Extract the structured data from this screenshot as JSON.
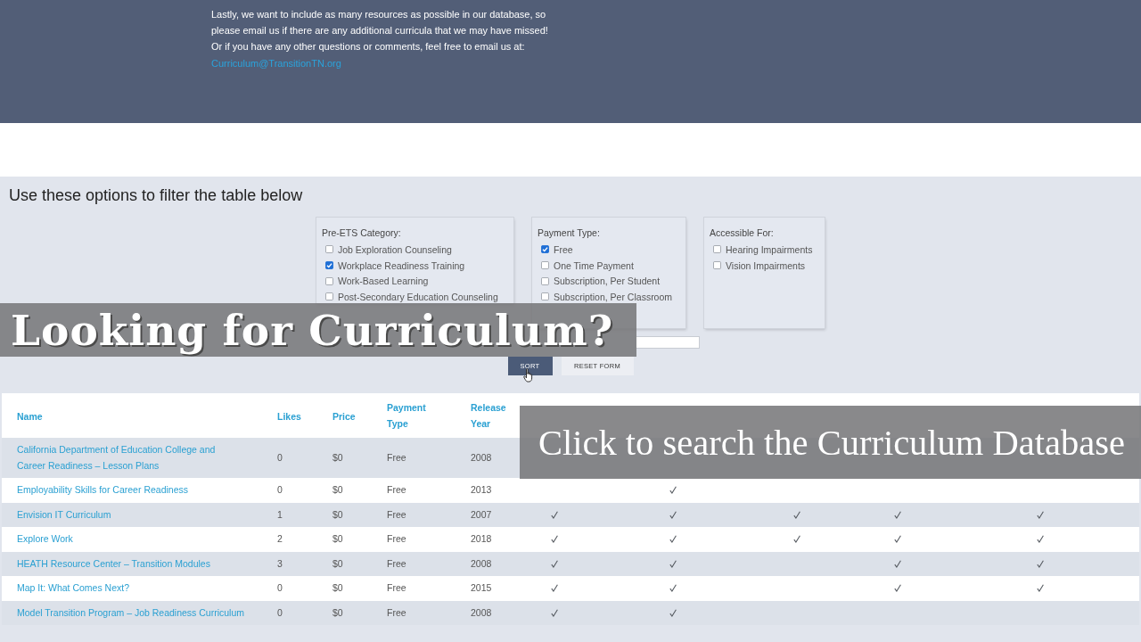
{
  "info_panel": {
    "paragraphs": [
      "Lastly, we want to include as many resources as possible in our database, so please email us if there are any additional curricula that we may have missed!",
      "Or if you have any other questions or comments, feel free to email us at:"
    ],
    "email_link": "Curriculum@TransitionTN.org"
  },
  "filters": {
    "heading": "Use these options to filter the table below",
    "groups": [
      {
        "title": "Pre-ETS Category:",
        "options": [
          {
            "label": "Job Exploration Counseling",
            "checked": false
          },
          {
            "label": "Workplace Readiness Training",
            "checked": true
          },
          {
            "label": "Work-Based Learning",
            "checked": false
          },
          {
            "label": "Post-Secondary Education Counseling",
            "checked": false
          }
        ]
      },
      {
        "title": "Payment Type:",
        "options": [
          {
            "label": "Free",
            "checked": true
          },
          {
            "label": "One Time Payment",
            "checked": false
          },
          {
            "label": "Subscription, Per Student",
            "checked": false
          },
          {
            "label": "Subscription, Per Classroom",
            "checked": false
          }
        ]
      },
      {
        "title": "Accessible For:",
        "options": [
          {
            "label": "Hearing Impairments",
            "checked": false
          },
          {
            "label": "Vision Impairments",
            "checked": false
          }
        ]
      }
    ],
    "buttons": [
      {
        "label": "SORT",
        "kind": "primary"
      },
      {
        "label": "RESET FORM",
        "kind": "secondary"
      }
    ]
  },
  "table": {
    "columns": [
      "Name",
      "Likes",
      "Price",
      "Payment Type",
      "Release Year"
    ],
    "rows": [
      {
        "name": "California Department of Education College and Career Readiness – Lesson Plans",
        "likes": "0",
        "price": "$0",
        "payment_type": "Free",
        "release_year": "2008"
      },
      {
        "name": "Employability Skills for Career Readiness",
        "likes": "0",
        "price": "$0",
        "payment_type": "Free",
        "release_year": "2013",
        "marks": [
          false,
          true,
          false,
          false,
          false
        ]
      },
      {
        "name": "Envision IT Curriculum",
        "likes": "1",
        "price": "$0",
        "payment_type": "Free",
        "release_year": "2007",
        "marks": [
          true,
          true,
          true,
          true,
          true
        ]
      },
      {
        "name": "Explore Work",
        "likes": "2",
        "price": "$0",
        "payment_type": "Free",
        "release_year": "2018",
        "marks": [
          true,
          true,
          true,
          true,
          true
        ]
      },
      {
        "name": "HEATH Resource Center – Transition Modules",
        "likes": "3",
        "price": "$0",
        "payment_type": "Free",
        "release_year": "2008",
        "marks": [
          true,
          true,
          false,
          true,
          true
        ]
      },
      {
        "name": "Map It: What Comes Next?",
        "likes": "0",
        "price": "$0",
        "payment_type": "Free",
        "release_year": "2015",
        "marks": [
          true,
          true,
          false,
          true,
          true
        ]
      },
      {
        "name": "Model Transition Program – Job Readiness Curriculum",
        "likes": "0",
        "price": "$0",
        "payment_type": "Free",
        "release_year": "2008",
        "marks": [
          true,
          true,
          false,
          false,
          false
        ]
      }
    ]
  },
  "overlays": [
    {
      "kind": "title",
      "text": "Looking for Curriculum?"
    },
    {
      "kind": "call_to_action",
      "text": "Click to search the Curriculum Database"
    }
  ]
}
